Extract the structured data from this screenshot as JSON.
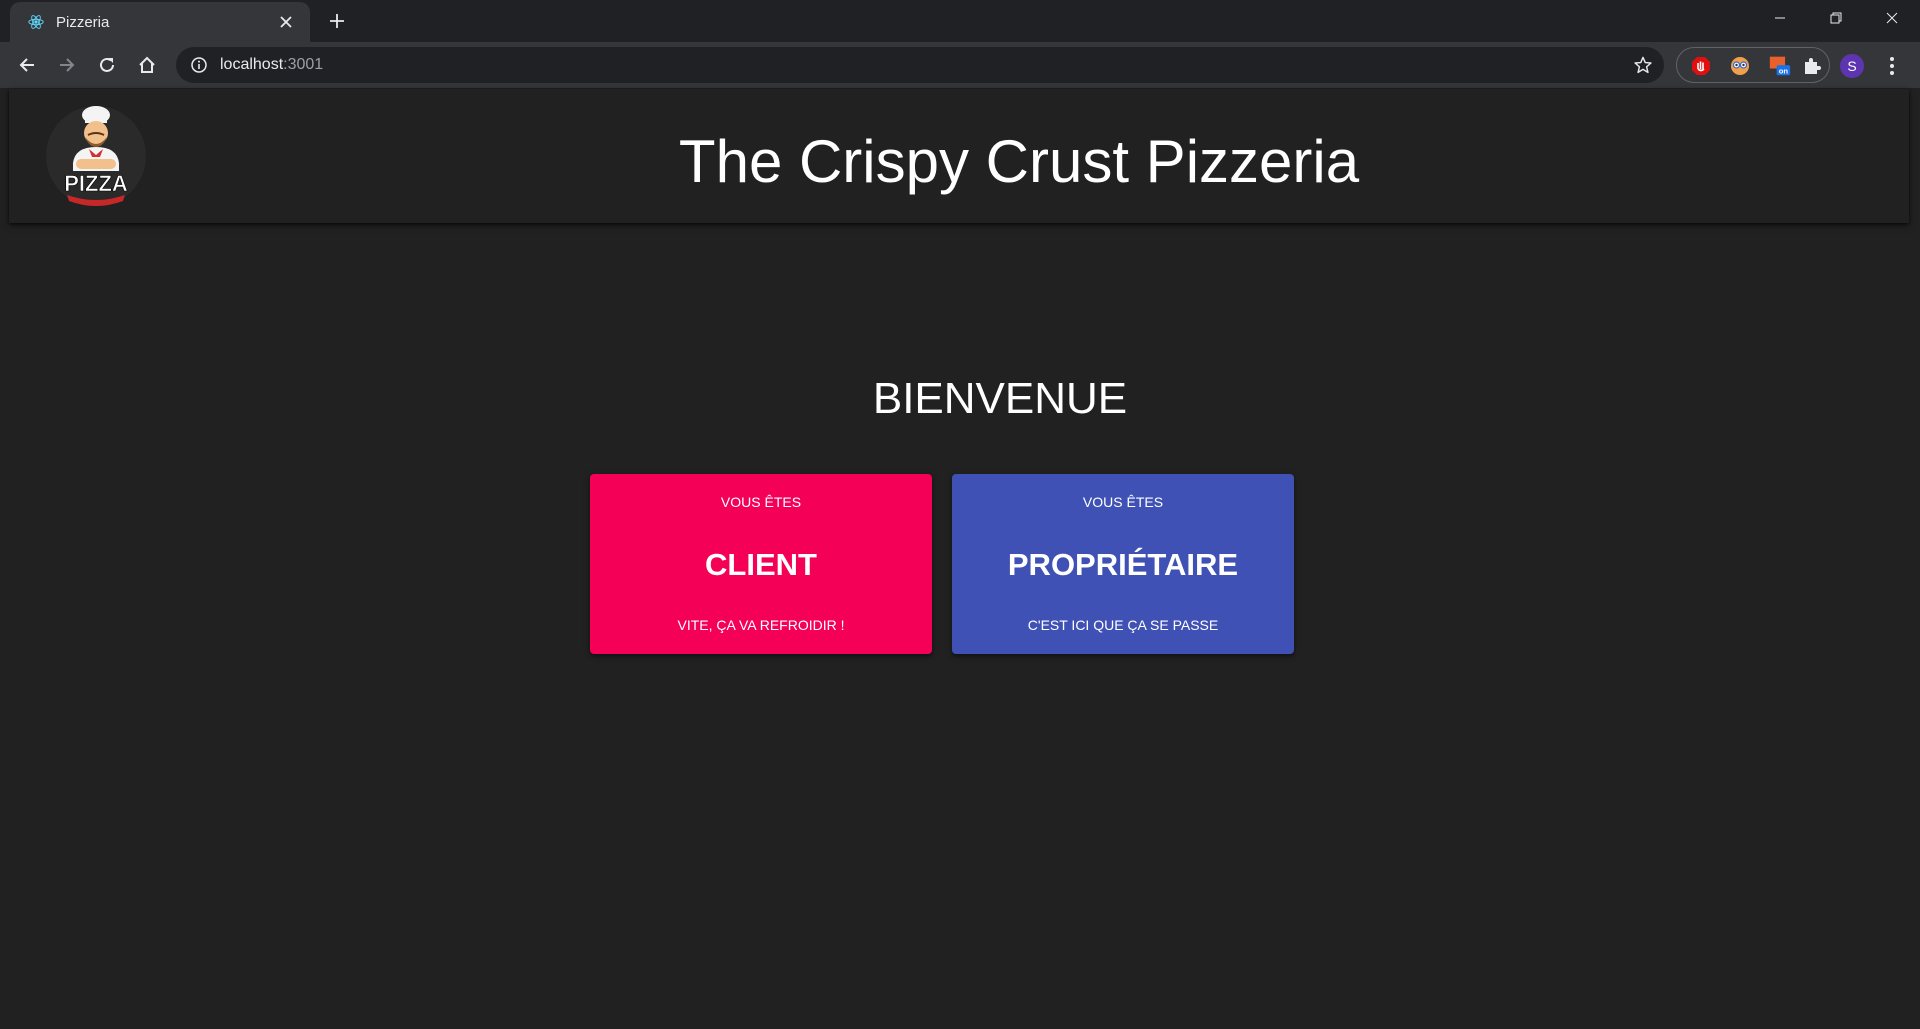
{
  "browser": {
    "tab_title": "Pizzeria",
    "url_host": "localhost",
    "url_port": ":3001",
    "profile_initial": "S"
  },
  "header": {
    "logo_text": "PIZZA",
    "title": "The Crispy Crust Pizzeria"
  },
  "main": {
    "welcome": "BIENVENUE",
    "cards": [
      {
        "top": "VOUS ÊTES",
        "main": "CLIENT",
        "bottom": "VITE, ÇA VA REFROIDIR !",
        "color": "#f50057"
      },
      {
        "top": "VOUS ÊTES",
        "main": "PROPRIÉTAIRE",
        "bottom": "C'EST ICI QUE ÇA SE PASSE",
        "color": "#3f51b5"
      }
    ]
  },
  "colors": {
    "page_bg": "#212121",
    "chrome_dark": "#202124",
    "chrome_toolbar": "#35363a",
    "accent_pink": "#f50057",
    "accent_indigo": "#3f51b5"
  }
}
